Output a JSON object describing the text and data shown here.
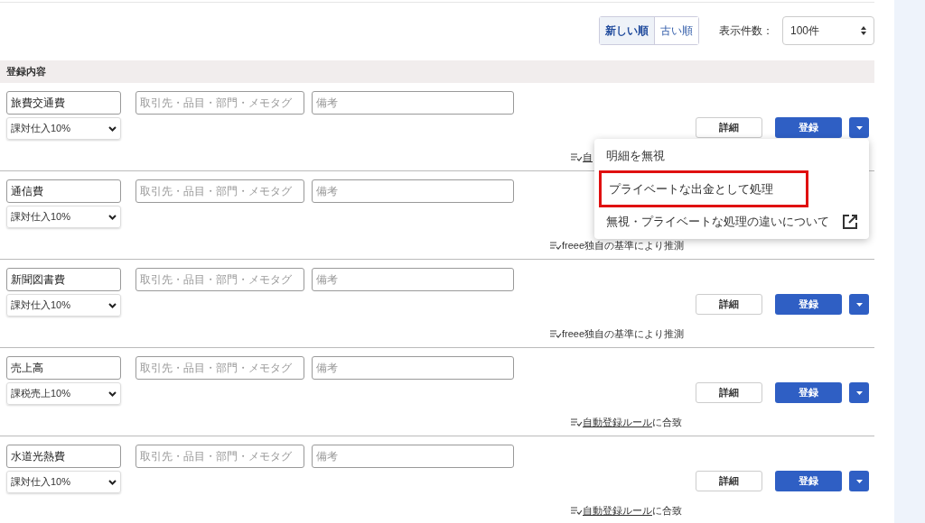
{
  "sort_toggle": [
    {
      "label": "新しい順",
      "selected": true
    },
    {
      "label": "古い順",
      "selected": false
    }
  ],
  "page_size": {
    "label": "表示件数：",
    "value": "100件"
  },
  "table_header": "登録内容",
  "rows": [
    {
      "category": "旅費交通費",
      "partner_placeholder": "取引先・品目・部門・メモタグ",
      "memo_placeholder": "備考",
      "tax": "課対仕入10%",
      "detail_button": "詳細",
      "register_button": "登録",
      "match": {
        "link": "自"
      }
    },
    {
      "category": "通信費",
      "partner_placeholder": "取引先・品目・部門・メモタグ",
      "memo_placeholder": "備考",
      "tax": "課対仕入10%",
      "match": {
        "text": "freee独自の基準により推測"
      }
    },
    {
      "category": "新聞図書費",
      "partner_placeholder": "取引先・品目・部門・メモタグ",
      "memo_placeholder": "備考",
      "tax": "課対仕入10%",
      "detail_button": "詳細",
      "register_button": "登録",
      "match": {
        "text": "freee独自の基準により推測"
      }
    },
    {
      "category": "売上高",
      "partner_placeholder": "取引先・品目・部門・メモタグ",
      "memo_placeholder": "備考",
      "tax": "課税売上10%",
      "detail_button": "詳細",
      "register_button": "登録",
      "match": {
        "link": "自動登録ルール",
        "text": "に合致"
      }
    },
    {
      "category": "水道光熱費",
      "partner_placeholder": "取引先・品目・部門・メモタグ",
      "memo_placeholder": "備考",
      "tax": "課対仕入10%",
      "detail_button": "詳細",
      "register_button": "登録",
      "match": {
        "link": "自動登録ルール",
        "text": "に合致"
      }
    }
  ],
  "dropdown_menu": {
    "items": [
      {
        "label": "明細を無視",
        "highlighted": false,
        "external": false
      },
      {
        "label": "プライベートな出金として処理",
        "highlighted": true,
        "external": false
      },
      {
        "label": "無視・プライベートな処理の違いについて",
        "highlighted": false,
        "external": true
      }
    ]
  }
}
